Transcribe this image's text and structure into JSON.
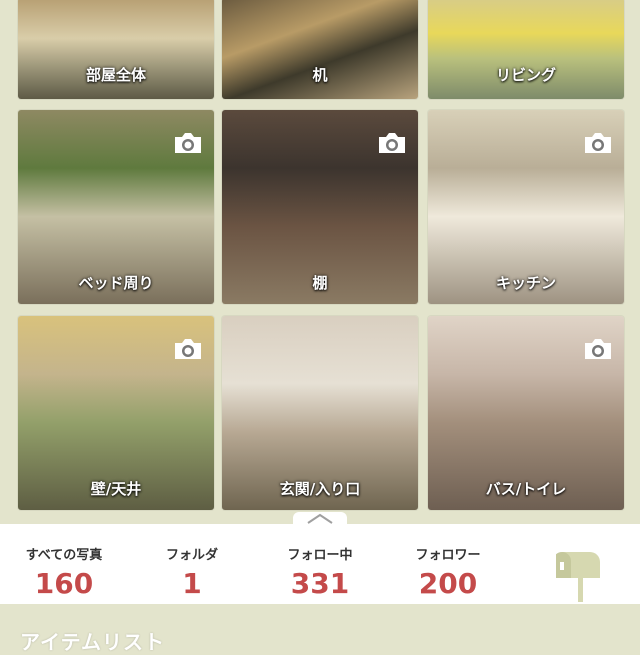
{
  "folders": [
    {
      "label": "部屋全体",
      "has_camera": false
    },
    {
      "label": "机",
      "has_camera": false
    },
    {
      "label": "リビング",
      "has_camera": false
    },
    {
      "label": "ベッド周り",
      "has_camera": true
    },
    {
      "label": "棚",
      "has_camera": true
    },
    {
      "label": "キッチン",
      "has_camera": true
    },
    {
      "label": "壁/天井",
      "has_camera": true
    },
    {
      "label": "玄関/入り口",
      "has_camera": false
    },
    {
      "label": "バス/トイレ",
      "has_camera": true
    }
  ],
  "stats": {
    "all_photos": {
      "label": "すべての写真",
      "value": "160"
    },
    "folders": {
      "label": "フォルダ",
      "value": "1"
    },
    "following": {
      "label": "フォロー中",
      "value": "331"
    },
    "followers": {
      "label": "フォロワー",
      "value": "200"
    }
  },
  "section_title": "アイテムリスト",
  "colors": {
    "background": "#e3e4cc",
    "stat_number": "#c44a4a",
    "mailbox": "#d6d8b0"
  },
  "icons": {
    "camera": "camera-icon",
    "mailbox": "mailbox-icon",
    "handle": "chevron-up-icon"
  }
}
